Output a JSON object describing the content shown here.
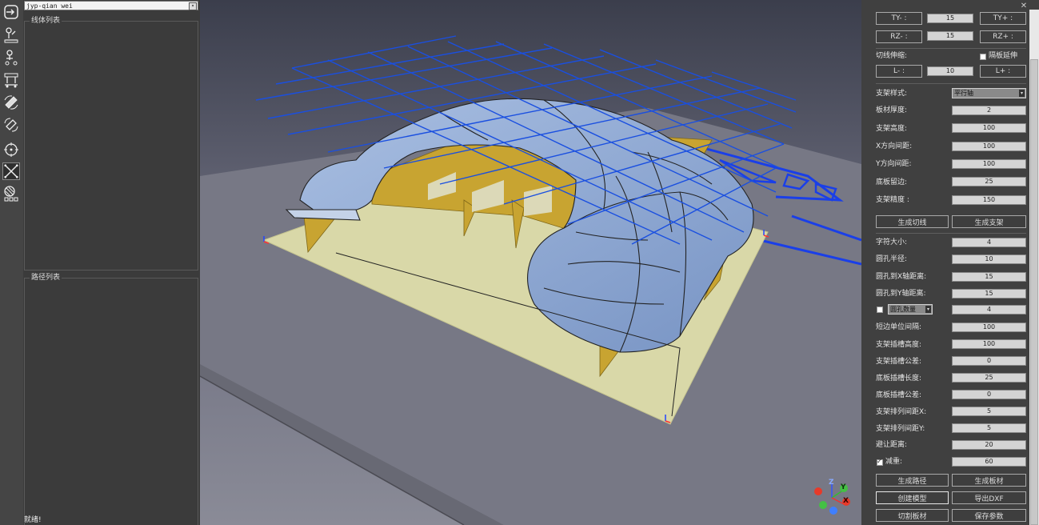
{
  "toolbar": {
    "icons": [
      "exit-icon",
      "import-part-icon",
      "place-part-icon",
      "support-icon",
      "rotate-view-icon",
      "pan-view-icon",
      "target-icon",
      "cut-cross-icon",
      "material-icon"
    ]
  },
  "left": {
    "project_name": "jyp-qian wei",
    "wire_list_title": "线体列表",
    "path_list_title": "路径列表",
    "status": "就绪!"
  },
  "right": {
    "ty_minus": "TY- :",
    "ty_value": "15",
    "ty_plus": "TY+ :",
    "rz_minus": "RZ- :",
    "rz_value": "15",
    "rz_plus": "RZ+ :",
    "cut_extend_label": "切线伸缩:",
    "board_extend_label": "隔板延伸",
    "l_minus": "L- :",
    "l_value": "10",
    "l_plus": "L+ :",
    "support_style_label": "支架样式:",
    "support_style_value": "平行轴",
    "board_thickness_label": "板材厚度:",
    "board_thickness_value": "2",
    "support_height_label": "支架高度:",
    "support_height_value": "100",
    "x_spacing_label": "X方向间距:",
    "x_spacing_value": "100",
    "y_spacing_label": "Y方向间距:",
    "y_spacing_value": "100",
    "base_margin_label": "底板留边:",
    "base_margin_value": "25",
    "support_precision_label": "支架精度 :",
    "support_precision_value": "150",
    "gen_cut_lines": "生成切线",
    "gen_supports": "生成支架",
    "font_size_label": "字符大小:",
    "font_size_value": "4",
    "hole_radius_label": "圆孔半径:",
    "hole_radius_value": "10",
    "hole_x_dist_label": "圆孔到X轴距离:",
    "hole_x_dist_value": "15",
    "hole_y_dist_label": "圆孔到Y轴距离:",
    "hole_y_dist_value": "15",
    "hole_count_label": "圆孔数量",
    "hole_count_value": "4",
    "edge_interval_label": "短边单位间隔:",
    "edge_interval_value": "100",
    "slot_height_label": "支架插槽高度:",
    "slot_height_value": "100",
    "slot_tolerance_label": "支架插槽公差:",
    "slot_tolerance_value": "0",
    "base_slot_length_label": "底板插槽长度:",
    "base_slot_length_value": "25",
    "base_slot_tolerance_label": "底板插槽公差:",
    "base_slot_tolerance_value": "0",
    "arrange_x_label": "支架排列间距X:",
    "arrange_x_value": "5",
    "arrange_y_label": "支架排列间距Y:",
    "arrange_y_value": "5",
    "avoid_dist_label": "避让距离:",
    "avoid_dist_value": "20",
    "weight_reduce_label": "减重:",
    "weight_reduce_value": "60",
    "gen_path": "生成路径",
    "gen_board": "生成板材",
    "create_model": "创建模型",
    "export_dxf": "导出DXF",
    "cut_board": "切割板材",
    "save_params": "保存参数",
    "close_glyph": "✕"
  },
  "axis": {
    "z": "Z",
    "y": "Y",
    "x": "X"
  },
  "colors": {
    "part": "#8aa8d6",
    "support": "#c8a431",
    "base": "#ddddb0",
    "grid": "#1a4fe0"
  }
}
